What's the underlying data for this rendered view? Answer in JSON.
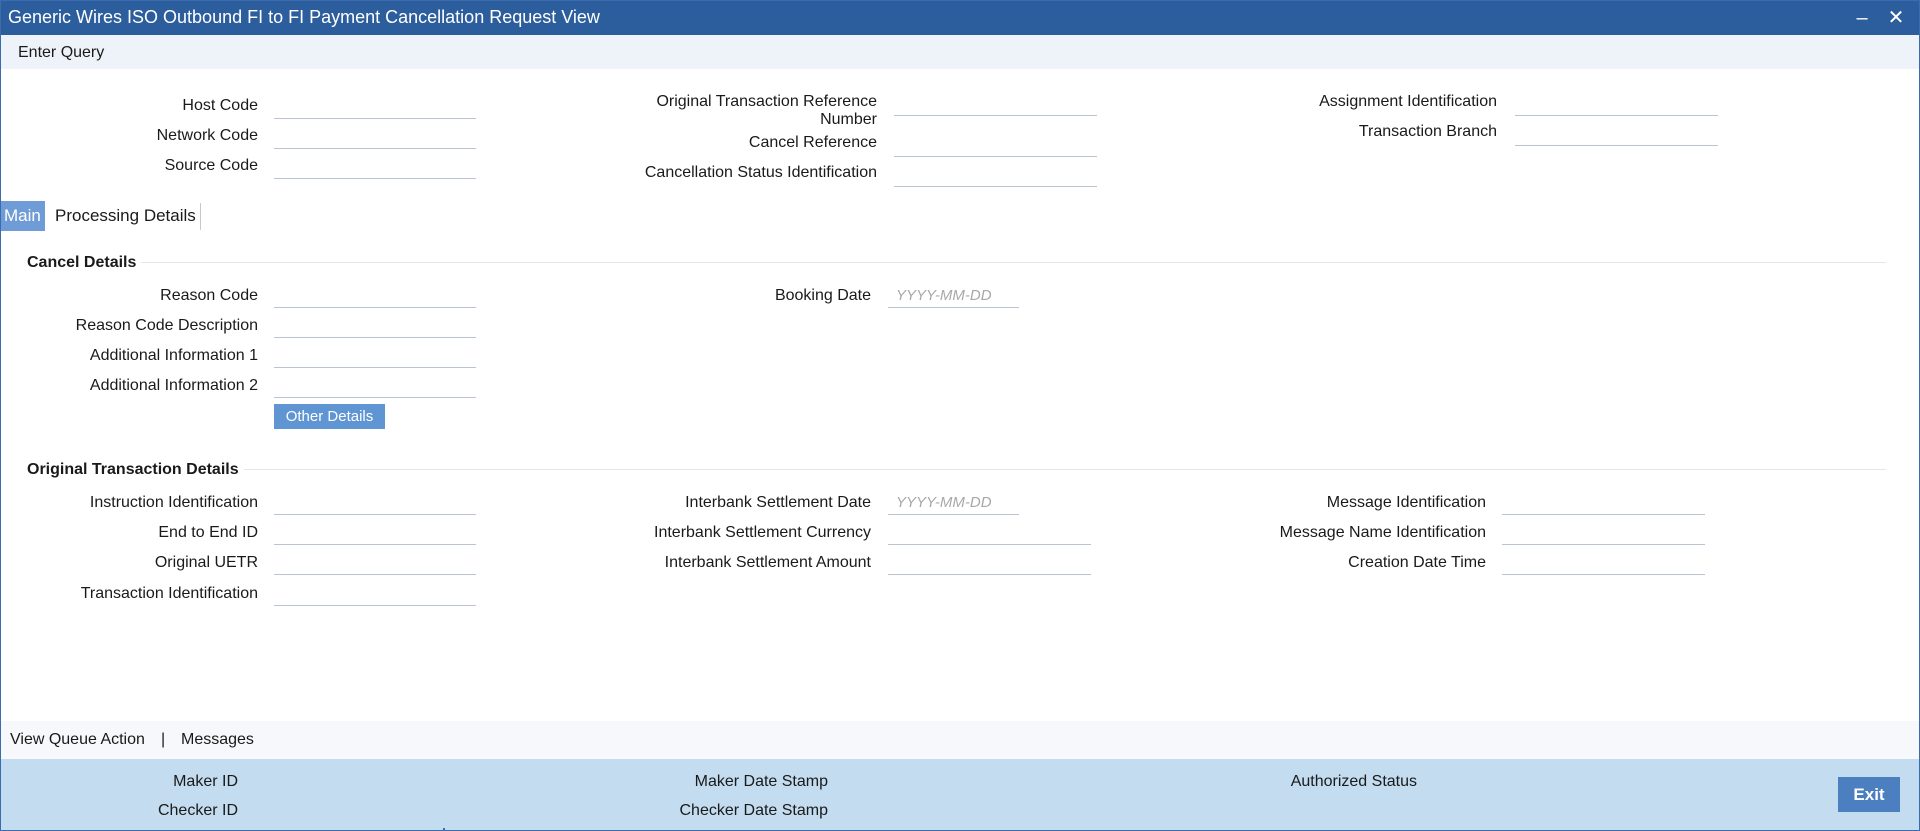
{
  "window": {
    "title": "Generic Wires ISO Outbound FI to FI Payment Cancellation Request View",
    "minimize_glyph": "‒",
    "close_glyph": "✕"
  },
  "menu": {
    "enter_query": "Enter Query"
  },
  "header": {
    "host_code": {
      "label": "Host Code",
      "value": ""
    },
    "network_code": {
      "label": "Network Code",
      "value": ""
    },
    "source_code": {
      "label": "Source Code",
      "value": ""
    },
    "original_txn_ref_line1": "Original Transaction Reference",
    "original_txn_ref_line2": "Number",
    "original_txn_ref_value": "",
    "cancel_reference": {
      "label": "Cancel Reference",
      "value": ""
    },
    "cancellation_status_id": {
      "label": "Cancellation Status Identification",
      "value": ""
    },
    "assignment_id": {
      "label": "Assignment Identification",
      "value": ""
    },
    "transaction_branch": {
      "label": "Transaction Branch",
      "value": ""
    }
  },
  "tabs": [
    {
      "label": "Main",
      "active": true
    },
    {
      "label": "Processing Details",
      "active": false
    }
  ],
  "cancel_details": {
    "title": "Cancel Details",
    "reason_code": {
      "label": "Reason Code",
      "value": ""
    },
    "reason_code_description": {
      "label": "Reason Code Description",
      "value": ""
    },
    "additional_info_1": {
      "label": "Additional Information 1",
      "value": ""
    },
    "additional_info_2": {
      "label": "Additional Information 2",
      "value": ""
    },
    "other_details_button": "Other Details",
    "booking_date": {
      "label": "Booking Date",
      "placeholder": "YYYY-MM-DD"
    }
  },
  "original_txn_details": {
    "title": "Original Transaction Details",
    "instruction_id": {
      "label": "Instruction Identification",
      "value": ""
    },
    "end_to_end_id": {
      "label": "End to End ID",
      "value": ""
    },
    "original_uetr": {
      "label": "Original UETR",
      "value": ""
    },
    "transaction_id": {
      "label": "Transaction Identification",
      "value": ""
    },
    "interbank_settlement_date": {
      "label": "Interbank Settlement Date",
      "placeholder": "YYYY-MM-DD"
    },
    "interbank_settlement_currency": {
      "label": "Interbank Settlement Currency",
      "value": ""
    },
    "interbank_settlement_amount": {
      "label": "Interbank Settlement Amount",
      "value": ""
    },
    "message_id": {
      "label": "Message Identification",
      "value": ""
    },
    "message_name_id": {
      "label": "Message Name Identification",
      "value": ""
    },
    "creation_date_time": {
      "label": "Creation Date Time",
      "value": ""
    }
  },
  "footer": {
    "view_queue_action": "View Queue Action",
    "separator": "|",
    "messages": "Messages"
  },
  "audit": {
    "maker_id": "Maker ID",
    "checker_id": "Checker ID",
    "maker_date_stamp": "Maker Date Stamp",
    "checker_date_stamp": "Checker Date Stamp",
    "authorized_status": "Authorized Status",
    "exit_button": "Exit"
  },
  "colors": {
    "titlebar": "#2c5d9c",
    "tab_active": "#6f9bd6",
    "button": "#5f95d3",
    "audit_bar": "#c3dcf0",
    "exit_button": "#4b7fbf"
  }
}
